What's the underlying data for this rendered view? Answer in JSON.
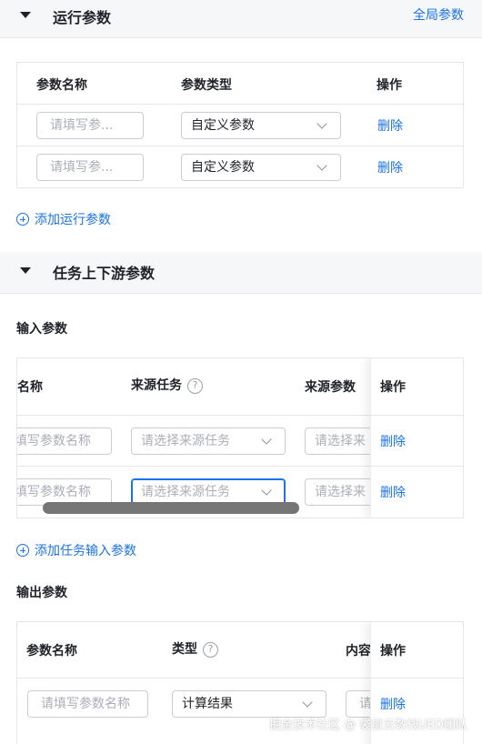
{
  "run_params": {
    "section_title": "运行参数",
    "global_link": "全局参数",
    "headers": {
      "name": "参数名称",
      "type": "参数类型",
      "action": "操作"
    },
    "rows": [
      {
        "name_placeholder": "请填写参...",
        "type": "自定义参数",
        "action": "删除"
      },
      {
        "name_placeholder": "请填写参...",
        "type": "自定义参数",
        "action": "删除"
      }
    ],
    "add_label": "添加运行参数"
  },
  "upstream": {
    "section_title": "任务上下游参数",
    "input": {
      "title": "输入参数",
      "headers": {
        "name": "名称",
        "source_task": "来源任务",
        "source_param": "来源参数",
        "action": "操作"
      },
      "rows": [
        {
          "name_placeholder": "填写参数名称",
          "task_placeholder": "请选择来源任务",
          "param_placeholder": "请选择来",
          "action": "删除"
        },
        {
          "name_placeholder": "填写参数名称",
          "task_placeholder": "请选择来源任务",
          "param_placeholder": "请选择来",
          "action": "删除"
        }
      ],
      "add_label": "添加任务输入参数"
    },
    "output": {
      "title": "输出参数",
      "headers": {
        "name": "参数名称",
        "type": "类型",
        "content": "内容",
        "action": "操作"
      },
      "rows": [
        {
          "name_placeholder": "请填写参数名称",
          "type": "计算结果",
          "content_placeholder": "请",
          "action": "删除"
        }
      ]
    }
  },
  "help_icon_glyph": "?",
  "watermark": "掘金技术社区 @ 袋鼠云数栈UED团队",
  "colors": {
    "link": "#1a73e8",
    "header_bg": "#f6f7f9",
    "border": "#e5e6eb"
  }
}
